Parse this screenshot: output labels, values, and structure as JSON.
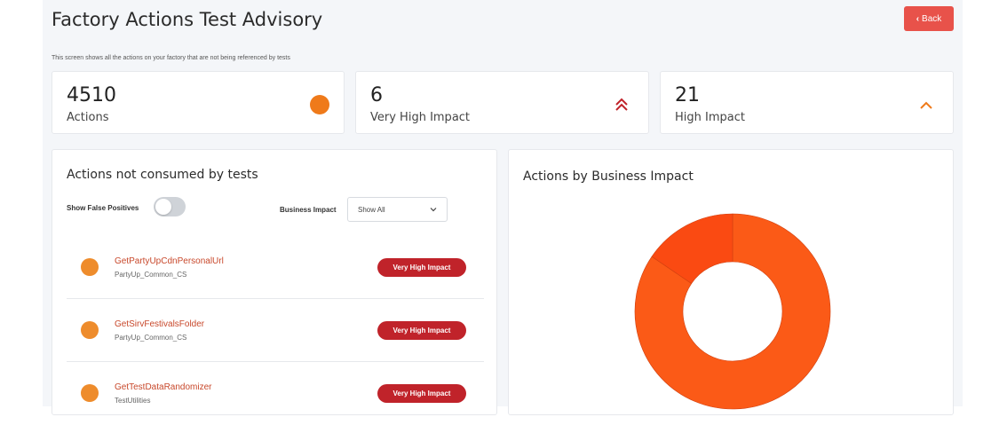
{
  "header": {
    "title": "Factory Actions Test Advisory",
    "back_label": "Back",
    "subtitle": "This screen shows all the actions on your factory that are not being referenced by tests"
  },
  "stats": [
    {
      "value": "4510",
      "label": "Actions",
      "icon": "orange-dot-icon"
    },
    {
      "value": "6",
      "label": "Very High Impact",
      "icon": "double-chevron-up-icon"
    },
    {
      "value": "21",
      "label": "High Impact",
      "icon": "chevron-up-icon"
    }
  ],
  "actions_panel": {
    "title": "Actions not consumed by tests",
    "toggle_label": "Show False Positives",
    "toggle_on": false,
    "filter_label": "Business Impact",
    "filter_value": "Show All",
    "items": [
      {
        "name": "GetPartyUpCdnPersonalUrl",
        "module": "PartyUp_Common_CS",
        "impact": "Very High Impact"
      },
      {
        "name": "GetSirvFestivalsFolder",
        "module": "PartyUp_Common_CS",
        "impact": "Very High Impact"
      },
      {
        "name": "GetTestDataRandomizer",
        "module": "TestUtilities",
        "impact": "Very High Impact"
      }
    ]
  },
  "chart_panel": {
    "title": "Actions by Business Impact"
  },
  "chart_data": {
    "type": "pie",
    "title": "Actions by Business Impact",
    "series": [
      {
        "name": "",
        "values": [
          0.845,
          0.155
        ]
      }
    ],
    "colors": [
      "#fb5a17",
      "#fa4a12"
    ]
  },
  "colors": {
    "accent": "#ef7a1a",
    "back_button": "#e8524a",
    "badge": "#c0232a",
    "link": "#c8482b"
  }
}
